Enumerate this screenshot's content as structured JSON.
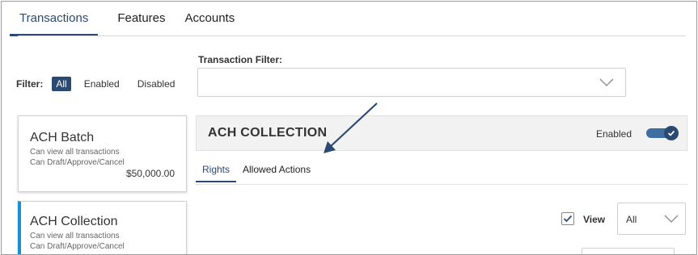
{
  "tabs": [
    {
      "label": "Transactions",
      "active": true
    },
    {
      "label": "Features",
      "active": false
    },
    {
      "label": "Accounts",
      "active": false
    }
  ],
  "filter": {
    "label": "Filter:",
    "options": [
      {
        "label": "All",
        "active": true
      },
      {
        "label": "Enabled",
        "active": false
      },
      {
        "label": "Disabled",
        "active": false
      }
    ]
  },
  "transaction_filter": {
    "label": "Transaction Filter:",
    "value": "",
    "icon": "chevron-down-icon"
  },
  "cards": [
    {
      "title": "ACH Batch",
      "line1": "Can view all transactions",
      "line2": "Can Draft/Approve/Cancel",
      "amount": "$50,000.00"
    },
    {
      "title": "ACH Collection",
      "line1": "Can view all transactions",
      "line2": "Can Draft/Approve/Cancel"
    }
  ],
  "detail": {
    "title": "ACH COLLECTION",
    "status_label": "Enabled",
    "toggle_on": true
  },
  "sub_tabs": [
    {
      "label": "Rights",
      "active": true
    },
    {
      "label": "Allowed Actions",
      "active": false
    }
  ],
  "rights": {
    "view_label": "View",
    "view_checked": true,
    "scope_value": "All"
  },
  "colors": {
    "accent": "#2b4a72",
    "selected_card_bar": "#1a8fd1",
    "annotation_arrow": "#2b4a72"
  }
}
